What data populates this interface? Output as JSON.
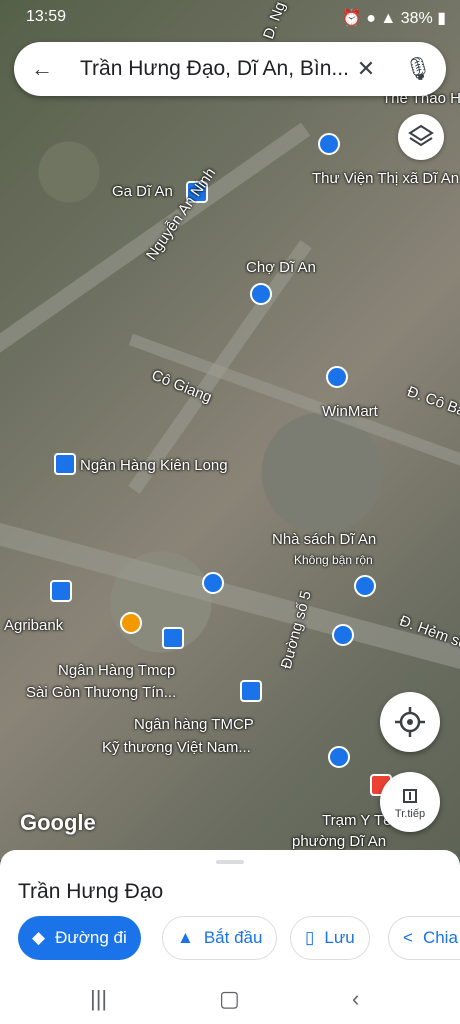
{
  "status_bar": {
    "time": "13:59",
    "battery": "38%"
  },
  "search": {
    "query": "Trần Hưng Đạo, Dĩ An, Bìn..."
  },
  "map_labels": [
    {
      "text": "Ga Dĩ An"
    },
    {
      "text": "Thư Viện Thị xã Dĩ An"
    },
    {
      "text": "Nguyễn An Ninh"
    },
    {
      "text": "Chợ Dĩ An"
    },
    {
      "text": "Cô Giang"
    },
    {
      "text": "WinMart"
    },
    {
      "text": "Đ. Cô Ba"
    },
    {
      "text": "Ngân Hàng Kiên Long"
    },
    {
      "text": "Nhà sách Dĩ An"
    },
    {
      "text": "Không bận rộn"
    },
    {
      "text": "Đường số 5"
    },
    {
      "text": "Agribank"
    },
    {
      "text": "Ngân Hàng Tmcp"
    },
    {
      "text": "Sài Gòn Thương Tín..."
    },
    {
      "text": "Ngân hàng TMCP"
    },
    {
      "text": "Kỹ thương Việt Nam..."
    },
    {
      "text": "Trạm Y Tế"
    },
    {
      "text": "phường Dĩ An"
    },
    {
      "text": "Đ. Hẻm số"
    },
    {
      "text": "Thể Thao H"
    },
    {
      "text": "D. Ng"
    }
  ],
  "map_controls": {
    "directions_fab_label": "Tr.tiếp"
  },
  "attribution": "Google",
  "sheet": {
    "title": "Trần Hưng Đạo",
    "actions": [
      {
        "label": "Đường đi"
      },
      {
        "label": "Bắt đầu"
      },
      {
        "label": "Lưu"
      },
      {
        "label": "Chia"
      }
    ]
  }
}
